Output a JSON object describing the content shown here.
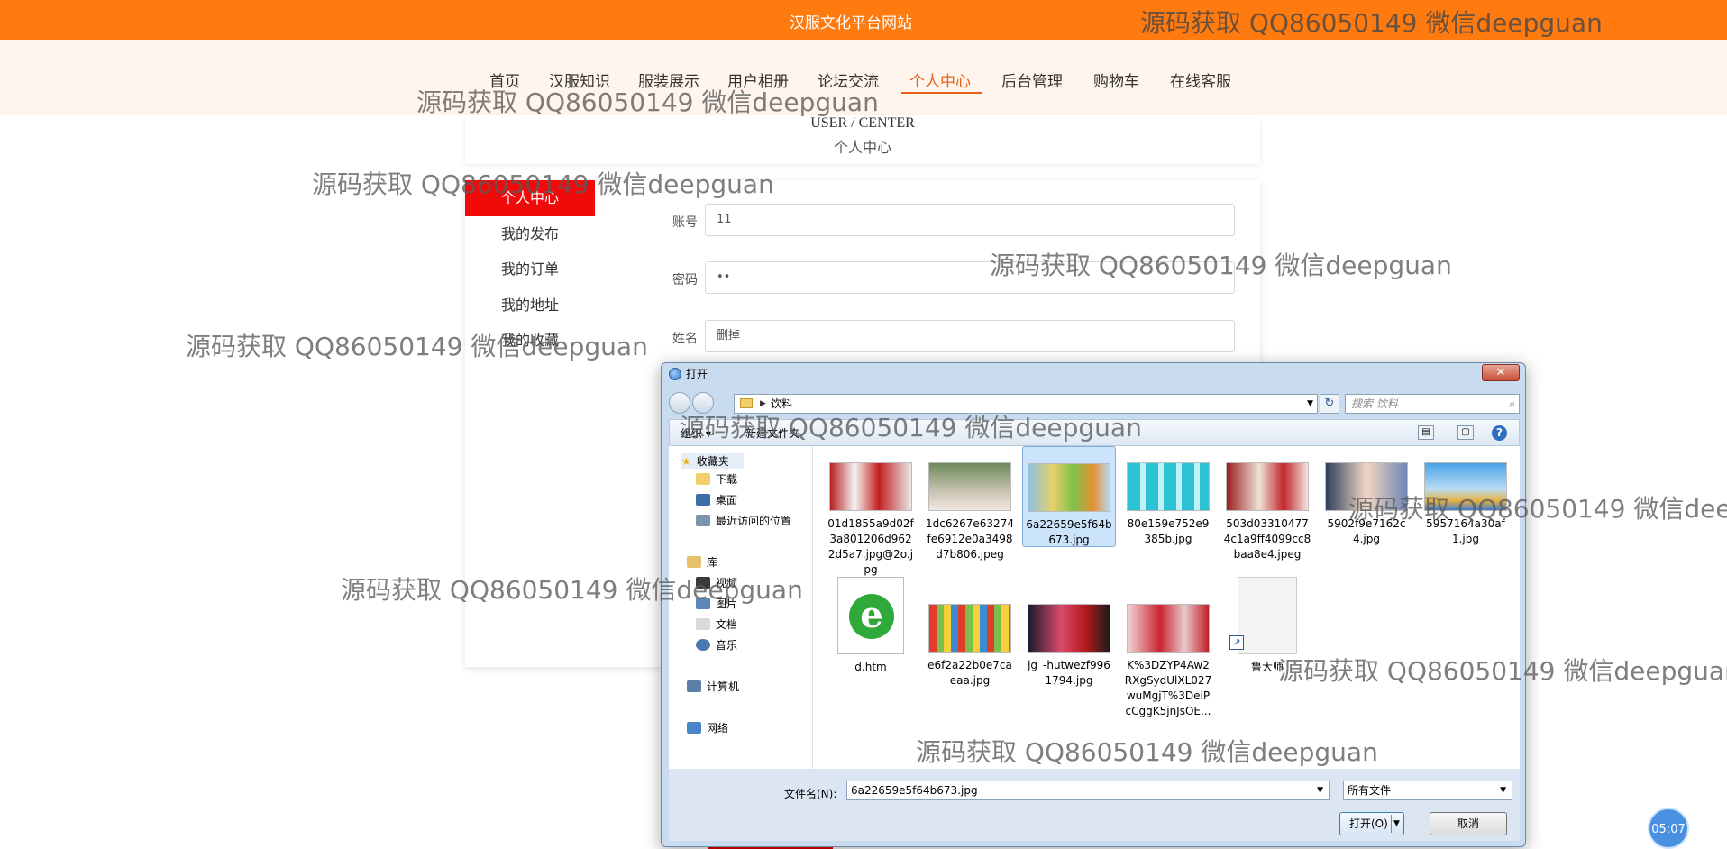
{
  "site": {
    "title": "汉服文化平台网站"
  },
  "nav": {
    "items": [
      {
        "label": "首页"
      },
      {
        "label": "汉服知识"
      },
      {
        "label": "服装展示"
      },
      {
        "label": "用户相册"
      },
      {
        "label": "论坛交流"
      },
      {
        "label": "个人中心",
        "active": true
      },
      {
        "label": "后台管理"
      },
      {
        "label": "购物车"
      },
      {
        "label": "在线客服"
      }
    ]
  },
  "header": {
    "title_en": "USER / CENTER",
    "title_zh": "个人中心"
  },
  "sidebar": {
    "items": [
      {
        "label": "个人中心",
        "active": true
      },
      {
        "label": "我的发布"
      },
      {
        "label": "我的订单"
      },
      {
        "label": "我的地址"
      },
      {
        "label": "我的收藏"
      }
    ]
  },
  "form": {
    "account": {
      "label": "账号",
      "value": "11"
    },
    "password": {
      "label": "密码",
      "value": "••"
    },
    "name": {
      "label": "姓名",
      "value": "删掉"
    }
  },
  "dialog": {
    "title": "打开",
    "close_label": "✕",
    "path": "饮料",
    "search_placeholder": "搜索 饮料",
    "toolbar": {
      "organize": "组织 ▾",
      "new_folder": "新建文件夹"
    },
    "tree": [
      {
        "label": "收藏夹",
        "icon": "star-icon"
      },
      {
        "label": "下载",
        "icon": "download-folder-icon"
      },
      {
        "label": "桌面",
        "icon": "desktop-icon"
      },
      {
        "label": "最近访问的位置",
        "icon": "recent-icon"
      },
      {
        "label": "库",
        "icon": "library-icon"
      },
      {
        "label": "视频",
        "icon": "video-icon"
      },
      {
        "label": "图片",
        "icon": "pictures-icon"
      },
      {
        "label": "文档",
        "icon": "documents-icon"
      },
      {
        "label": "音乐",
        "icon": "music-icon"
      },
      {
        "label": "计算机",
        "icon": "computer-icon"
      },
      {
        "label": "网络",
        "icon": "network-icon"
      }
    ],
    "files": [
      {
        "name": "01d1855a9d02f3a801206d9622d5a7.jpg@2o.jpg"
      },
      {
        "name": "1dc6267e63274fe6912e0a3498d7b806.jpeg"
      },
      {
        "name": "6a22659e5f64b673.jpg",
        "selected": true
      },
      {
        "name": "80e159e752e9385b.jpg"
      },
      {
        "name": "503d033104774c1a9ff4099cc8baa8e4.jpeg"
      },
      {
        "name": "5902f9e7162c4.jpg"
      },
      {
        "name": "5957164a30af1.jpg"
      },
      {
        "name": "d.htm"
      },
      {
        "name": "e6f2a22b0e7caeaa.jpg"
      },
      {
        "name": "jg_-hutwezf9961794.jpg"
      },
      {
        "name": "K%3DZYP4Aw2RXgSydUlXL027wuMgjT%3DeiPcCggK5jnJsOE..."
      },
      {
        "name": "鲁大师"
      }
    ],
    "filename_label": "文件名(N):",
    "filename_value": "6a22659e5f64b673.jpg",
    "filetype_value": "所有文件",
    "open_label": "打开(O)",
    "cancel_label": "取消"
  },
  "clock": "05:07",
  "watermark": {
    "text": "源码获取 QQ86050149 微信deepguan"
  },
  "colors": {
    "topbar": "#ff7a0f",
    "active_nav": "#e5611c",
    "sidebar_active": "#f20a0a"
  }
}
